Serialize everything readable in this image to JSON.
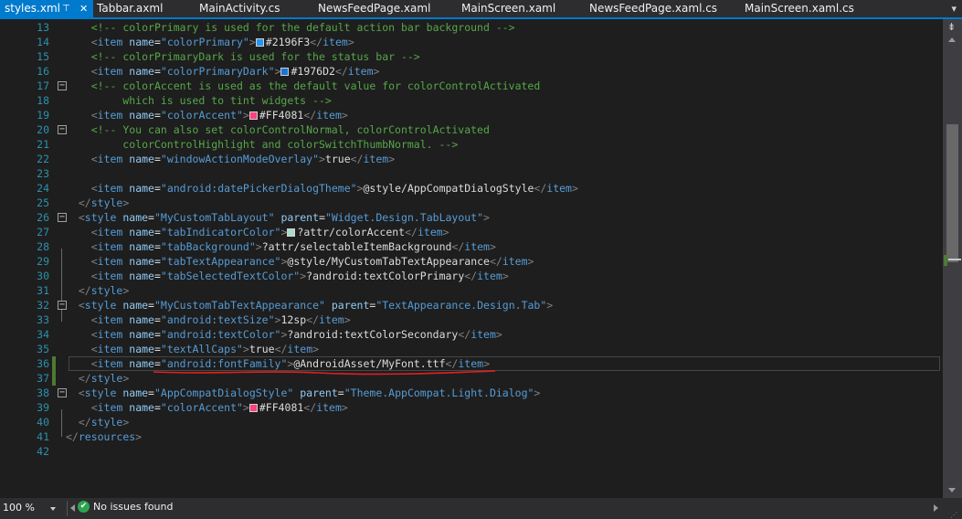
{
  "tabs": [
    {
      "label": "styles.xml",
      "active": true,
      "pin_icon": "pin-icon",
      "close_icon": "close-icon"
    },
    {
      "label": "Tabbar.axml"
    },
    {
      "label": "MainActivity.cs"
    },
    {
      "label": "NewsFeedPage.xaml"
    },
    {
      "label": "MainScreen.xaml"
    },
    {
      "label": "NewsFeedPage.xaml.cs"
    },
    {
      "label": "MainScreen.xaml.cs"
    }
  ],
  "lines": [
    {
      "n": "13",
      "code": [
        [
          "    ",
          "t-txt"
        ],
        [
          "<!-- colorPrimary is used for the default action bar background -->",
          "t-cmt"
        ]
      ]
    },
    {
      "n": "14",
      "code": [
        [
          "    ",
          "t-txt"
        ],
        [
          "<",
          "t-del"
        ],
        [
          "item",
          "t-tag"
        ],
        [
          " name",
          "t-attr"
        ],
        [
          "=",
          "t-txt"
        ],
        [
          "\"colorPrimary\"",
          "t-str"
        ],
        [
          ">",
          "t-del"
        ],
        [
          "SW:#2196F3",
          ""
        ],
        [
          "#2196F3",
          "t-txt"
        ],
        [
          "</",
          "t-del"
        ],
        [
          "item",
          "t-tag"
        ],
        [
          ">",
          "t-del"
        ]
      ]
    },
    {
      "n": "15",
      "code": [
        [
          "    ",
          "t-txt"
        ],
        [
          "<!-- colorPrimaryDark is used for the status bar -->",
          "t-cmt"
        ]
      ]
    },
    {
      "n": "16",
      "code": [
        [
          "    ",
          "t-txt"
        ],
        [
          "<",
          "t-del"
        ],
        [
          "item",
          "t-tag"
        ],
        [
          " name",
          "t-attr"
        ],
        [
          "=",
          "t-txt"
        ],
        [
          "\"colorPrimaryDark\"",
          "t-str"
        ],
        [
          ">",
          "t-del"
        ],
        [
          "SW:#1976D2",
          ""
        ],
        [
          "#1976D2",
          "t-txt"
        ],
        [
          "</",
          "t-del"
        ],
        [
          "item",
          "t-tag"
        ],
        [
          ">",
          "t-del"
        ]
      ]
    },
    {
      "n": "17",
      "code": [
        [
          "    ",
          "t-txt"
        ],
        [
          "<!-- colorAccent is used as the default value for colorControlActivated",
          "t-cmt"
        ]
      ]
    },
    {
      "n": "18",
      "code": [
        [
          "         which is used to tint widgets -->",
          "t-cmt"
        ]
      ]
    },
    {
      "n": "19",
      "code": [
        [
          "    ",
          "t-txt"
        ],
        [
          "<",
          "t-del"
        ],
        [
          "item",
          "t-tag"
        ],
        [
          " name",
          "t-attr"
        ],
        [
          "=",
          "t-txt"
        ],
        [
          "\"colorAccent\"",
          "t-str"
        ],
        [
          ">",
          "t-del"
        ],
        [
          "SW:#FF4081",
          ""
        ],
        [
          "#FF4081",
          "t-txt"
        ],
        [
          "</",
          "t-del"
        ],
        [
          "item",
          "t-tag"
        ],
        [
          ">",
          "t-del"
        ]
      ]
    },
    {
      "n": "20",
      "code": [
        [
          "    ",
          "t-txt"
        ],
        [
          "<!-- You can also set colorControlNormal, colorControlActivated",
          "t-cmt"
        ]
      ]
    },
    {
      "n": "21",
      "code": [
        [
          "         colorControlHighlight and colorSwitchThumbNormal. -->",
          "t-cmt"
        ]
      ]
    },
    {
      "n": "22",
      "code": [
        [
          "    ",
          "t-txt"
        ],
        [
          "<",
          "t-del"
        ],
        [
          "item",
          "t-tag"
        ],
        [
          " name",
          "t-attr"
        ],
        [
          "=",
          "t-txt"
        ],
        [
          "\"windowActionModeOverlay\"",
          "t-str"
        ],
        [
          ">",
          "t-del"
        ],
        [
          "true",
          "t-txt"
        ],
        [
          "</",
          "t-del"
        ],
        [
          "item",
          "t-tag"
        ],
        [
          ">",
          "t-del"
        ]
      ]
    },
    {
      "n": "23",
      "code": []
    },
    {
      "n": "24",
      "code": [
        [
          "    ",
          "t-txt"
        ],
        [
          "<",
          "t-del"
        ],
        [
          "item",
          "t-tag"
        ],
        [
          " name",
          "t-attr"
        ],
        [
          "=",
          "t-txt"
        ],
        [
          "\"android:datePickerDialogTheme\"",
          "t-str"
        ],
        [
          ">",
          "t-del"
        ],
        [
          "@style/AppCompatDialogStyle",
          "t-txt"
        ],
        [
          "</",
          "t-del"
        ],
        [
          "item",
          "t-tag"
        ],
        [
          ">",
          "t-del"
        ]
      ]
    },
    {
      "n": "25",
      "code": [
        [
          "  ",
          "t-txt"
        ],
        [
          "</",
          "t-del"
        ],
        [
          "style",
          "t-tag"
        ],
        [
          ">",
          "t-del"
        ]
      ]
    },
    {
      "n": "26",
      "code": [
        [
          "  ",
          "t-txt"
        ],
        [
          "<",
          "t-del"
        ],
        [
          "style",
          "t-tag"
        ],
        [
          " name",
          "t-attr"
        ],
        [
          "=",
          "t-txt"
        ],
        [
          "\"MyCustomTabLayout\"",
          "t-str"
        ],
        [
          " parent",
          "t-attr"
        ],
        [
          "=",
          "t-txt"
        ],
        [
          "\"Widget.Design.TabLayout\"",
          "t-str"
        ],
        [
          ">",
          "t-del"
        ]
      ]
    },
    {
      "n": "27",
      "code": [
        [
          "    ",
          "t-txt"
        ],
        [
          "<",
          "t-del"
        ],
        [
          "item",
          "t-tag"
        ],
        [
          " name",
          "t-attr"
        ],
        [
          "=",
          "t-txt"
        ],
        [
          "\"tabIndicatorColor\"",
          "t-str"
        ],
        [
          ">",
          "t-del"
        ],
        [
          "SW:#a8dcc8",
          ""
        ],
        [
          "?attr/colorAccent",
          "t-txt"
        ],
        [
          "</",
          "t-del"
        ],
        [
          "item",
          "t-tag"
        ],
        [
          ">",
          "t-del"
        ]
      ]
    },
    {
      "n": "28",
      "code": [
        [
          "    ",
          "t-txt"
        ],
        [
          "<",
          "t-del"
        ],
        [
          "item",
          "t-tag"
        ],
        [
          " name",
          "t-attr"
        ],
        [
          "=",
          "t-txt"
        ],
        [
          "\"tabBackground\"",
          "t-str"
        ],
        [
          ">",
          "t-del"
        ],
        [
          "?attr/selectableItemBackground",
          "t-txt"
        ],
        [
          "</",
          "t-del"
        ],
        [
          "item",
          "t-tag"
        ],
        [
          ">",
          "t-del"
        ]
      ]
    },
    {
      "n": "29",
      "code": [
        [
          "    ",
          "t-txt"
        ],
        [
          "<",
          "t-del"
        ],
        [
          "item",
          "t-tag"
        ],
        [
          " name",
          "t-attr"
        ],
        [
          "=",
          "t-txt"
        ],
        [
          "\"tabTextAppearance\"",
          "t-str"
        ],
        [
          ">",
          "t-del"
        ],
        [
          "@style/MyCustomTabTextAppearance",
          "t-txt"
        ],
        [
          "</",
          "t-del"
        ],
        [
          "item",
          "t-tag"
        ],
        [
          ">",
          "t-del"
        ]
      ]
    },
    {
      "n": "30",
      "code": [
        [
          "    ",
          "t-txt"
        ],
        [
          "<",
          "t-del"
        ],
        [
          "item",
          "t-tag"
        ],
        [
          " name",
          "t-attr"
        ],
        [
          "=",
          "t-txt"
        ],
        [
          "\"tabSelectedTextColor\"",
          "t-str"
        ],
        [
          ">",
          "t-del"
        ],
        [
          "?android:textColorPrimary",
          "t-txt"
        ],
        [
          "</",
          "t-del"
        ],
        [
          "item",
          "t-tag"
        ],
        [
          ">",
          "t-del"
        ]
      ]
    },
    {
      "n": "31",
      "code": [
        [
          "  ",
          "t-txt"
        ],
        [
          "</",
          "t-del"
        ],
        [
          "style",
          "t-tag"
        ],
        [
          ">",
          "t-del"
        ]
      ]
    },
    {
      "n": "32",
      "code": [
        [
          "  ",
          "t-txt"
        ],
        [
          "<",
          "t-del"
        ],
        [
          "style",
          "t-tag"
        ],
        [
          " name",
          "t-attr"
        ],
        [
          "=",
          "t-txt"
        ],
        [
          "\"MyCustomTabTextAppearance\"",
          "t-str"
        ],
        [
          " parent",
          "t-attr"
        ],
        [
          "=",
          "t-txt"
        ],
        [
          "\"TextAppearance.Design.Tab\"",
          "t-str"
        ],
        [
          ">",
          "t-del"
        ]
      ]
    },
    {
      "n": "33",
      "code": [
        [
          "    ",
          "t-txt"
        ],
        [
          "<",
          "t-del"
        ],
        [
          "item",
          "t-tag"
        ],
        [
          " name",
          "t-attr"
        ],
        [
          "=",
          "t-txt"
        ],
        [
          "\"android:textSize\"",
          "t-str"
        ],
        [
          ">",
          "t-del"
        ],
        [
          "12sp",
          "t-txt"
        ],
        [
          "</",
          "t-del"
        ],
        [
          "item",
          "t-tag"
        ],
        [
          ">",
          "t-del"
        ]
      ]
    },
    {
      "n": "34",
      "code": [
        [
          "    ",
          "t-txt"
        ],
        [
          "<",
          "t-del"
        ],
        [
          "item",
          "t-tag"
        ],
        [
          " name",
          "t-attr"
        ],
        [
          "=",
          "t-txt"
        ],
        [
          "\"android:textColor\"",
          "t-str"
        ],
        [
          ">",
          "t-del"
        ],
        [
          "?android:textColorSecondary",
          "t-txt"
        ],
        [
          "</",
          "t-del"
        ],
        [
          "item",
          "t-tag"
        ],
        [
          ">",
          "t-del"
        ]
      ]
    },
    {
      "n": "35",
      "code": [
        [
          "    ",
          "t-txt"
        ],
        [
          "<",
          "t-del"
        ],
        [
          "item",
          "t-tag"
        ],
        [
          " name",
          "t-attr"
        ],
        [
          "=",
          "t-txt"
        ],
        [
          "\"textAllCaps\"",
          "t-str"
        ],
        [
          ">",
          "t-del"
        ],
        [
          "true",
          "t-txt"
        ],
        [
          "</",
          "t-del"
        ],
        [
          "item",
          "t-tag"
        ],
        [
          ">",
          "t-del"
        ]
      ]
    },
    {
      "n": "36",
      "code": [
        [
          "    ",
          "t-txt"
        ],
        [
          "<",
          "t-del"
        ],
        [
          "item",
          "t-tag"
        ],
        [
          " name",
          "t-attr"
        ],
        [
          "=",
          "t-txt"
        ],
        [
          "\"android:fontFamily\"",
          "t-str"
        ],
        [
          ">",
          "t-del"
        ],
        [
          "@AndroidAsset/MyFont.ttf",
          "t-txt"
        ],
        [
          "</",
          "t-del"
        ],
        [
          "item",
          "t-tag"
        ],
        [
          ">",
          "t-del"
        ]
      ]
    },
    {
      "n": "37",
      "code": [
        [
          "  ",
          "t-txt"
        ],
        [
          "</",
          "t-del"
        ],
        [
          "style",
          "t-tag"
        ],
        [
          ">",
          "t-del"
        ]
      ]
    },
    {
      "n": "38",
      "code": [
        [
          "  ",
          "t-txt"
        ],
        [
          "<",
          "t-del"
        ],
        [
          "style",
          "t-tag"
        ],
        [
          " name",
          "t-attr"
        ],
        [
          "=",
          "t-txt"
        ],
        [
          "\"AppCompatDialogStyle\"",
          "t-str"
        ],
        [
          " parent",
          "t-attr"
        ],
        [
          "=",
          "t-txt"
        ],
        [
          "\"Theme.AppCompat.Light.Dialog\"",
          "t-str"
        ],
        [
          ">",
          "t-del"
        ]
      ]
    },
    {
      "n": "39",
      "code": [
        [
          "    ",
          "t-txt"
        ],
        [
          "<",
          "t-del"
        ],
        [
          "item",
          "t-tag"
        ],
        [
          " name",
          "t-attr"
        ],
        [
          "=",
          "t-txt"
        ],
        [
          "\"colorAccent\"",
          "t-str"
        ],
        [
          ">",
          "t-del"
        ],
        [
          "SW:#FF4081",
          ""
        ],
        [
          "#FF4081",
          "t-txt"
        ],
        [
          "</",
          "t-del"
        ],
        [
          "item",
          "t-tag"
        ],
        [
          ">",
          "t-del"
        ]
      ]
    },
    {
      "n": "40",
      "code": [
        [
          "  ",
          "t-txt"
        ],
        [
          "</",
          "t-del"
        ],
        [
          "style",
          "t-tag"
        ],
        [
          ">",
          "t-del"
        ]
      ]
    },
    {
      "n": "41",
      "code": [
        [
          "</",
          "t-del"
        ],
        [
          "resources",
          "t-tag"
        ],
        [
          ">",
          "t-del"
        ]
      ]
    },
    {
      "n": "42",
      "code": []
    }
  ],
  "fold_lines": [
    "17",
    "20",
    "26",
    "32",
    "38"
  ],
  "status": {
    "zoom": "100 %",
    "issues": "No issues found",
    "issues_icon": "check-circle-icon"
  },
  "colors": {
    "accent": "#007acc",
    "annotation_underline": "#e02020",
    "change_marker": "#4d7a31"
  }
}
